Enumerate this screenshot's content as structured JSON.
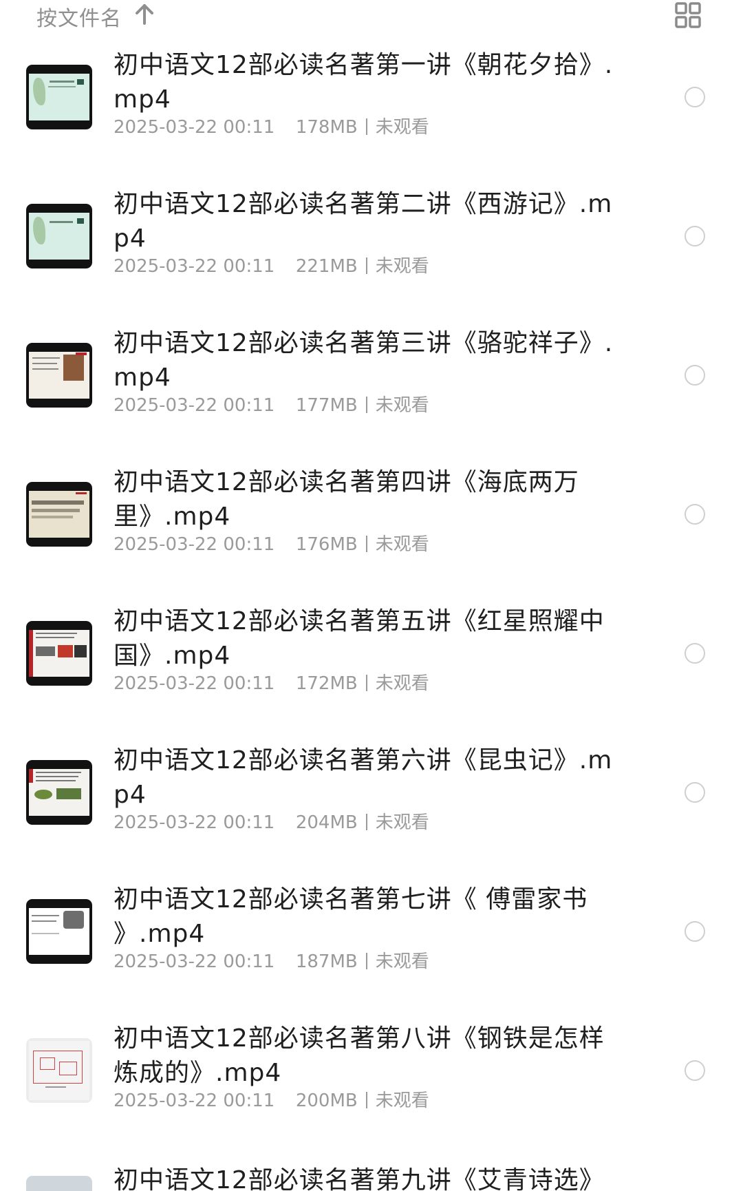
{
  "toolbar": {
    "sort_label": "按文件名",
    "sort_icon": "arrow-up-icon",
    "view_icon": "grid-view-icon"
  },
  "files": [
    {
      "title": "初中语文12部必读名著第一讲《朝花夕拾》.mp4",
      "date": "2025-03-22 00:11",
      "size": "178MB",
      "status": "未观看"
    },
    {
      "title": "初中语文12部必读名著第二讲《西游记》.mp4",
      "date": "2025-03-22 00:11",
      "size": "221MB",
      "status": "未观看"
    },
    {
      "title": "初中语文12部必读名著第三讲《骆驼祥子》.mp4",
      "date": "2025-03-22 00:11",
      "size": "177MB",
      "status": "未观看"
    },
    {
      "title": "初中语文12部必读名著第四讲《海底两万里》.mp4",
      "date": "2025-03-22 00:11",
      "size": "176MB",
      "status": "未观看"
    },
    {
      "title": "初中语文12部必读名著第五讲《红星照耀中国》.mp4",
      "date": "2025-03-22 00:11",
      "size": "172MB",
      "status": "未观看"
    },
    {
      "title": "初中语文12部必读名著第六讲《昆虫记》.mp4",
      "date": "2025-03-22 00:11",
      "size": "204MB",
      "status": "未观看"
    },
    {
      "title": "初中语文12部必读名著第七讲《 傅雷家书 》.mp4",
      "date": "2025-03-22 00:11",
      "size": "187MB",
      "status": "未观看"
    },
    {
      "title": "初中语文12部必读名著第八讲《钢铁是怎样炼成的》.mp4",
      "date": "2025-03-22 00:11",
      "size": "200MB",
      "status": "未观看"
    }
  ],
  "partial_file": {
    "title": "初中语文12部必读名著第九讲《艾青诗选》"
  },
  "colors": {
    "muted_text": "#9a9a9a",
    "title_text": "#1f1f1f",
    "radio_border": "#cfcfcf",
    "thumb_frame": "#121212"
  }
}
